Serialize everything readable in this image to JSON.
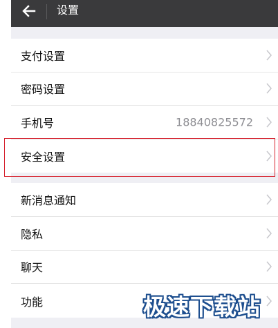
{
  "header": {
    "back_icon": "arrow-left-icon",
    "title": "设置"
  },
  "groups": [
    {
      "items": [
        {
          "label": "支付设置",
          "value": ""
        },
        {
          "label": "密码设置",
          "value": ""
        },
        {
          "label": "手机号",
          "value": "18840825572"
        },
        {
          "label": "安全设置",
          "value": "",
          "highlighted": true
        }
      ]
    },
    {
      "items": [
        {
          "label": "新消息通知",
          "value": ""
        },
        {
          "label": "隐私",
          "value": ""
        },
        {
          "label": "聊天",
          "value": ""
        },
        {
          "label": "功能",
          "value": ""
        }
      ]
    }
  ],
  "watermark": "极速下载站",
  "colors": {
    "topbar": "#3a3a3c",
    "background": "#efeff4",
    "highlight_border": "#d6212e",
    "secondary_text": "#8e8e93",
    "watermark_outline": "#1e4f8f"
  }
}
